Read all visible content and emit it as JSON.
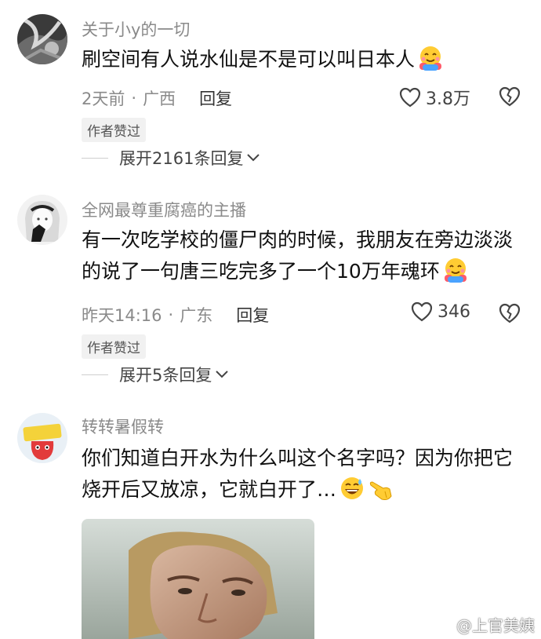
{
  "comments": [
    {
      "username": "关于小y的一切",
      "text": "刷空间有人说水仙是不是可以叫日本人",
      "emoji": "hugging-face-emoji",
      "time": "2天前",
      "location": "广西",
      "reply_label": "回复",
      "likes": "3.8万",
      "author_tag": "作者赞过",
      "expand_label": "展开2161条回复"
    },
    {
      "username": "全网最尊重腐癌的主播",
      "text": "有一次吃学校的僵尸肉的时候，我朋友在旁边淡淡的说了一句唐三吃完多了一个10万年魂环",
      "emoji": "hugging-face-emoji",
      "time": "昨天14:16",
      "location": "广东",
      "reply_label": "回复",
      "likes": "346",
      "author_tag": "作者赞过",
      "expand_label": "展开5条回复"
    },
    {
      "username": "转转暑假转",
      "text": "你们知道白开水为什么叫这个名字吗？因为你把它烧开后又放凉，它就白开了…",
      "emoji": "grinning-sweat-emoji",
      "emoji2": "pointing-hand-emoji"
    }
  ],
  "watermark": "@上官美姨",
  "colors": {
    "meta_gray": "#8a8a8a",
    "text": "#111111",
    "tag_bg": "#f1f1f1"
  }
}
